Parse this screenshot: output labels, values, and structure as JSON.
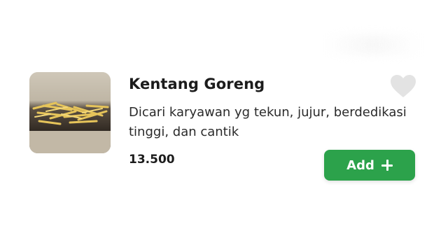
{
  "product": {
    "name": "Kentang Goreng",
    "description": "Dicari karyawan yg tekun, jujur, berdedikasi tinggi, dan cantik",
    "price": "13.500",
    "image_icon": "fries-image",
    "favorite_icon": "heart-icon"
  },
  "actions": {
    "add_label": "Add",
    "add_icon": "plus-icon"
  },
  "colors": {
    "accent": "#2ca24b",
    "heart": "#e3e3e3",
    "text": "#1c1c1c"
  }
}
